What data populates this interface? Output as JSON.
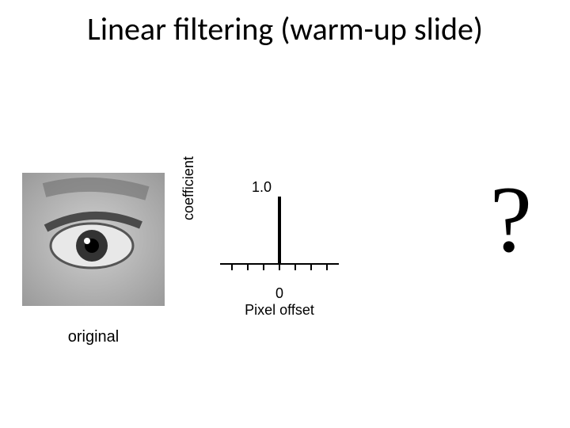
{
  "title": "Linear filtering (warm-up slide)",
  "image": {
    "caption": "original"
  },
  "chart_data": {
    "type": "bar",
    "x": [
      -3,
      -2,
      -1,
      0,
      1,
      2,
      3
    ],
    "values": [
      0,
      0,
      0,
      1.0,
      0,
      0,
      0
    ],
    "value_label": "1.0",
    "center_tick_label": "0",
    "xlabel": "Pixel offset",
    "ylabel": "coefficient",
    "ylim": [
      0,
      1.0
    ]
  },
  "result": "?"
}
